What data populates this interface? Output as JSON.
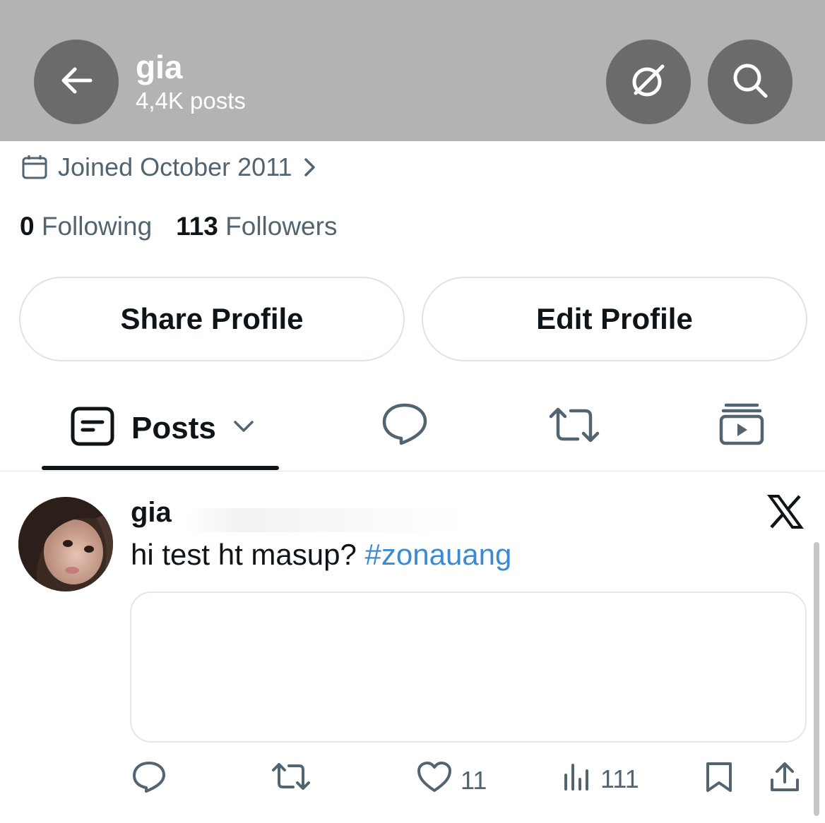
{
  "header": {
    "name": "gia",
    "post_count": "4,4K posts",
    "back_icon": "arrow-left-icon",
    "grok_icon": "grok-icon",
    "search_icon": "search-icon",
    "background_color": "#b3b3b3",
    "button_color": "#6b6b6b"
  },
  "profile": {
    "joined": "Joined October 2011",
    "joined_icon": "calendar-icon",
    "following_count": "0",
    "following_label": "Following",
    "followers_count": "113",
    "followers_label": "Followers"
  },
  "buttons": {
    "share_label": "Share Profile",
    "edit_label": "Edit Profile"
  },
  "tabs": {
    "posts_label": "Posts",
    "items": [
      "posts-icon",
      "replies-icon",
      "reposts-icon",
      "media-icon"
    ]
  },
  "post": {
    "author": "gia",
    "text": "hi test ht masup?",
    "hashtag": "#zonauang",
    "likes": "11",
    "views": "111",
    "hashtag_color": "#3b8ad2"
  }
}
